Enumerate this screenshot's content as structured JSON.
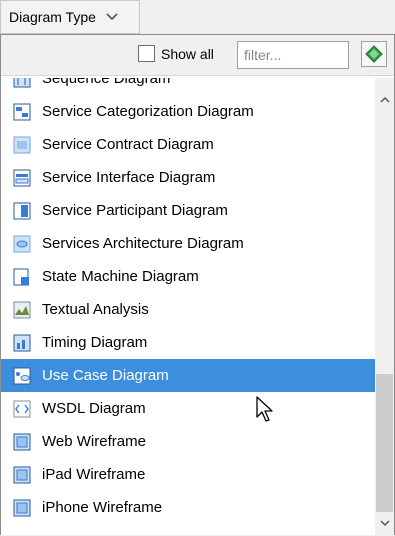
{
  "dropdown": {
    "label": "Diagram Type",
    "chevron": "⌄"
  },
  "toolbar": {
    "show_all_label": "Show all",
    "filter_placeholder": "filter...",
    "action_icon": "green-diamond-icon"
  },
  "list": {
    "items": [
      {
        "label": "Sequence Diagram",
        "icon": "sequence-diagram-icon"
      },
      {
        "label": "Service Categorization Diagram",
        "icon": "service-categorization-icon"
      },
      {
        "label": "Service Contract Diagram",
        "icon": "service-contract-icon"
      },
      {
        "label": "Service Interface Diagram",
        "icon": "service-interface-icon"
      },
      {
        "label": "Service Participant Diagram",
        "icon": "service-participant-icon"
      },
      {
        "label": "Services Architecture Diagram",
        "icon": "services-architecture-icon"
      },
      {
        "label": "State Machine Diagram",
        "icon": "state-machine-icon"
      },
      {
        "label": "Textual Analysis",
        "icon": "textual-analysis-icon"
      },
      {
        "label": "Timing Diagram",
        "icon": "timing-diagram-icon"
      },
      {
        "label": "Use Case Diagram",
        "icon": "use-case-icon",
        "selected": true
      },
      {
        "label": "WSDL Diagram",
        "icon": "wsdl-icon"
      },
      {
        "label": "Web Wireframe",
        "icon": "web-wireframe-icon"
      },
      {
        "label": "iPad Wireframe",
        "icon": "ipad-wireframe-icon"
      },
      {
        "label": "iPhone Wireframe",
        "icon": "iphone-wireframe-icon"
      }
    ]
  },
  "scroll": {
    "up": "⌃",
    "down": "⌄"
  },
  "colors": {
    "selection": "#3d8fdd"
  }
}
